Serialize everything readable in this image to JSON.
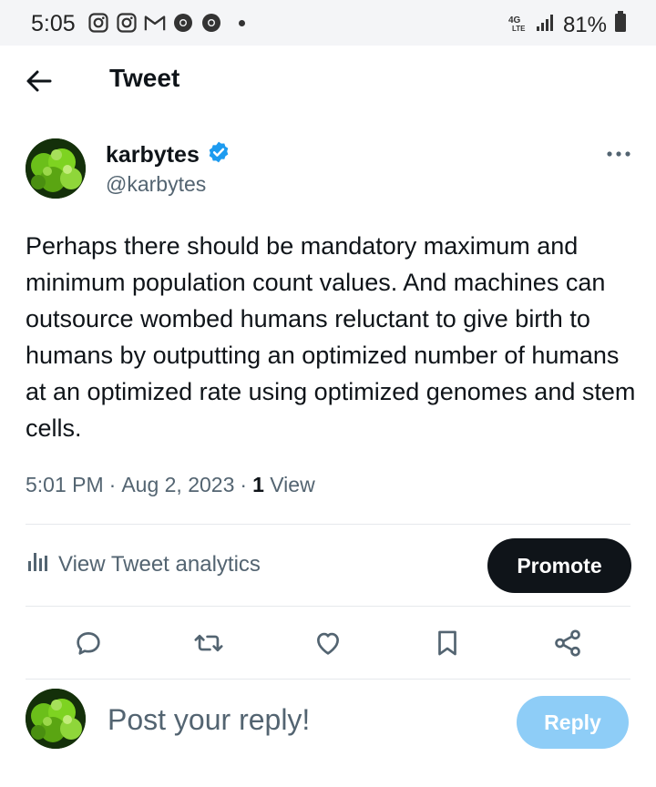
{
  "status_bar": {
    "time": "5:05",
    "network": "4G LTE",
    "battery": "81%",
    "app_icons": [
      "instagram-icon",
      "instagram-icon",
      "gmail-icon",
      "chrome-icon",
      "chrome-icon"
    ]
  },
  "header": {
    "title": "Tweet"
  },
  "tweet": {
    "author_name": "karbytes",
    "verified": true,
    "handle": "@karbytes",
    "text": "Perhaps there should be mandatory maximum and minimum population count values. And machines can outsource wombed humans reluctant to give birth to humans by outputting an optimized number of humans at an optimized rate using optimized genomes and stem cells.",
    "time": "5:01 PM",
    "date": "Aug 2, 2023",
    "views_count": "1",
    "views_label": "View"
  },
  "analytics": {
    "label": "View Tweet analytics",
    "promote_label": "Promote"
  },
  "actions": [
    "reply-icon",
    "retweet-icon",
    "like-icon",
    "bookmark-icon",
    "share-icon"
  ],
  "reply": {
    "placeholder": "Post your reply!",
    "button_label": "Reply"
  },
  "colors": {
    "verified": "#1d9bf0",
    "reply_button": "#8ecdf7",
    "promote_button": "#0f1419",
    "secondary_text": "#536471"
  }
}
